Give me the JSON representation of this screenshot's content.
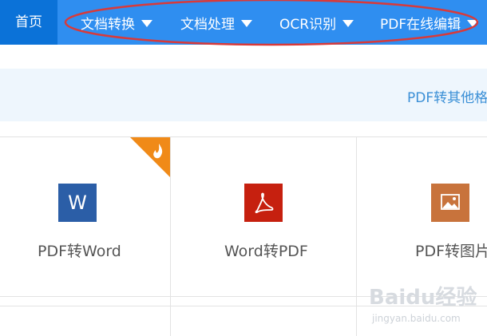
{
  "nav": {
    "home": "首页",
    "items": [
      {
        "label": "文档转换"
      },
      {
        "label": "文档处理"
      },
      {
        "label": "OCR识别"
      },
      {
        "label": "PDF在线编辑"
      }
    ]
  },
  "banner": {
    "link": "PDF转其他格式"
  },
  "cards": [
    {
      "label": "PDF转Word",
      "icon": "word-icon",
      "icon_text": "W",
      "color": "#2b5ea7",
      "hot": true
    },
    {
      "label": "Word转PDF",
      "icon": "acrobat-icon",
      "color": "#c6200f"
    },
    {
      "label": "PDF转图片",
      "icon": "image-icon",
      "color": "#c8733c"
    }
  ],
  "watermark": {
    "brand": "Baidu经验",
    "url": "jingyan.baidu.com"
  },
  "colors": {
    "nav_bg": "#2f8ef0",
    "nav_active": "#0b72d8",
    "annotation": "#d83a3a"
  }
}
